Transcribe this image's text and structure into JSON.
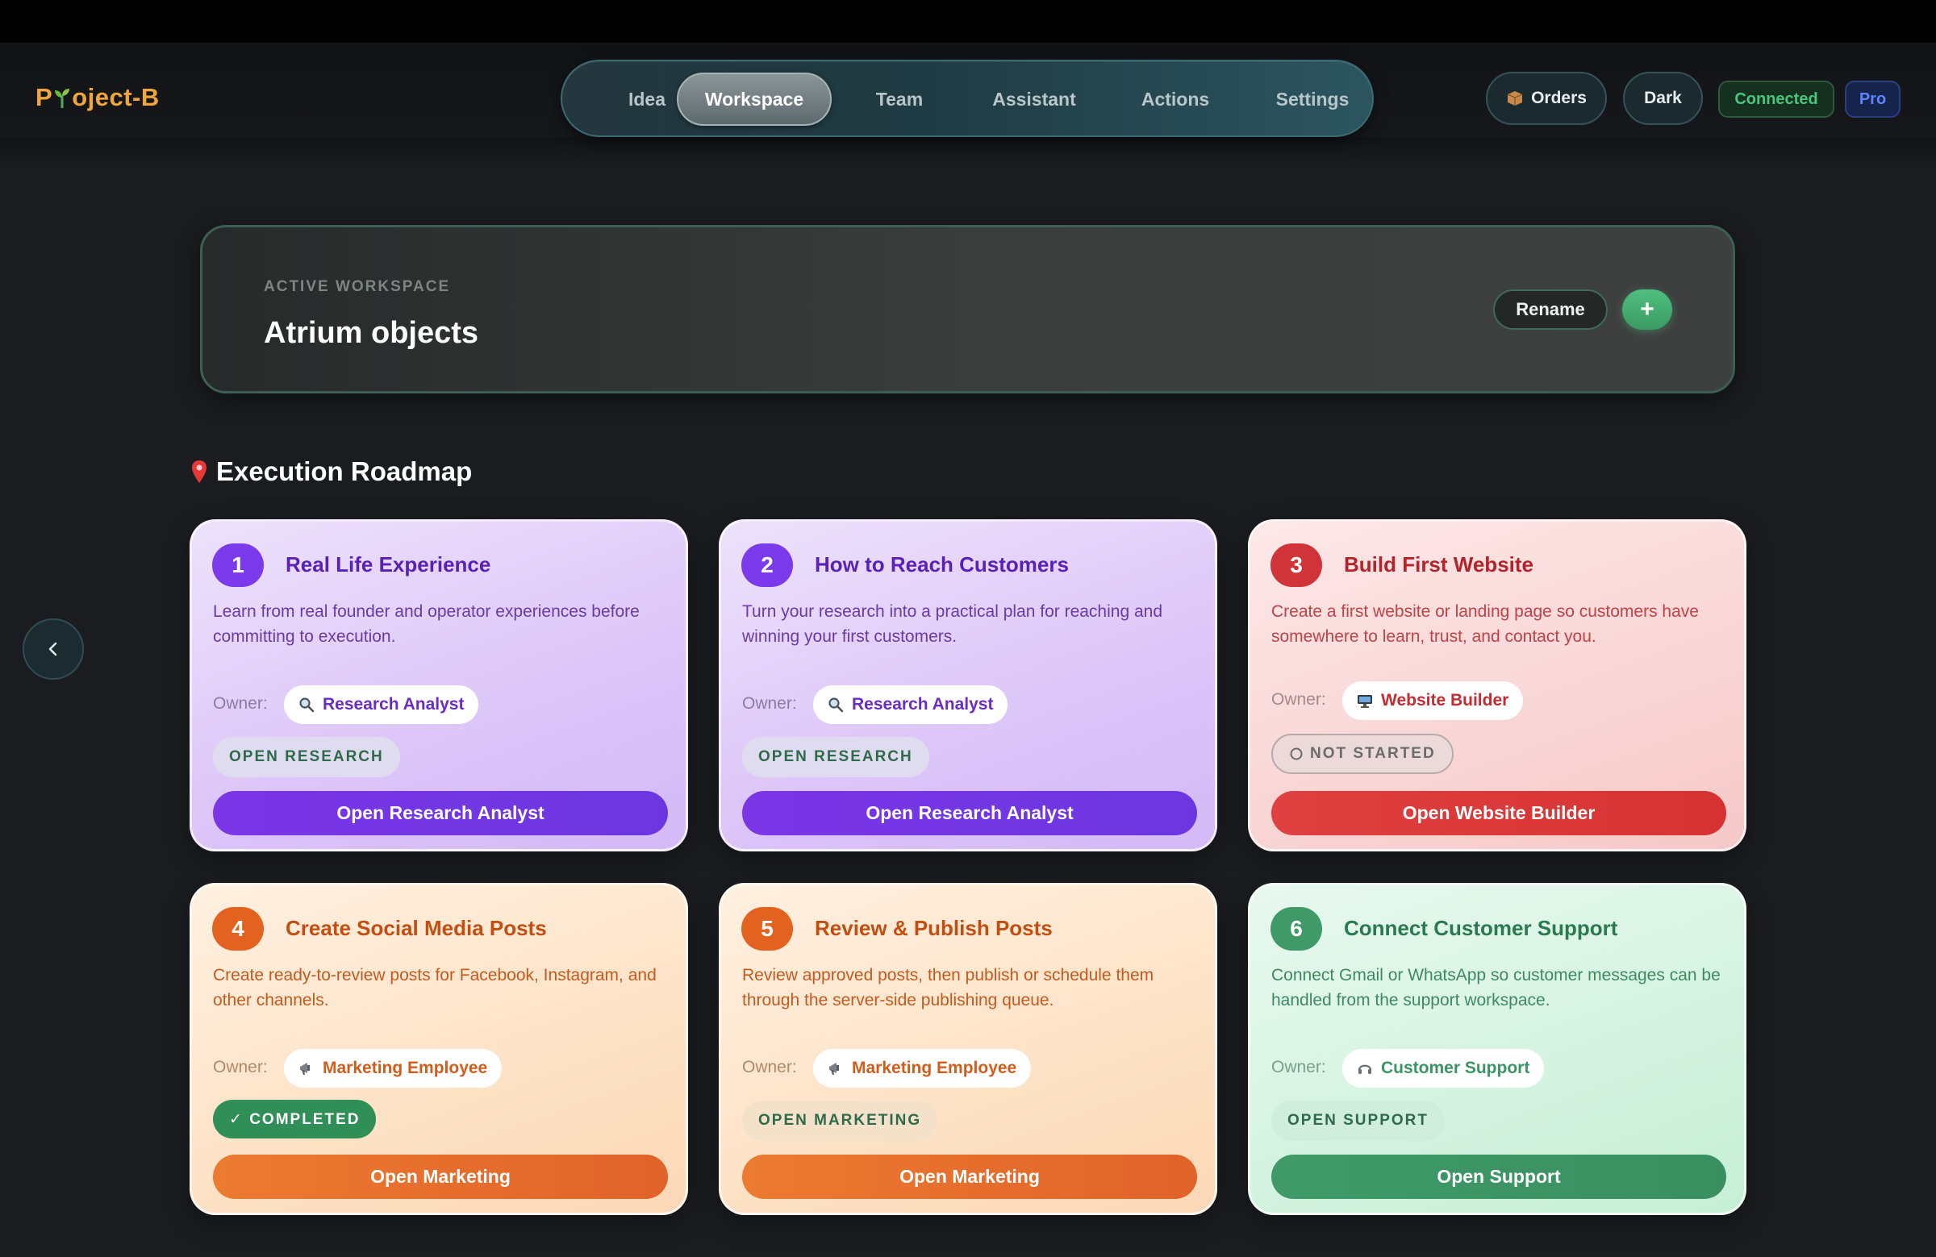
{
  "app": {
    "logo_left": "P",
    "logo_right": "oject-B"
  },
  "nav": {
    "items": [
      {
        "label": "Idea"
      },
      {
        "label": "Workspace",
        "active": true
      },
      {
        "label": "Team"
      },
      {
        "label": "Assistant"
      },
      {
        "label": "Actions"
      },
      {
        "label": "Settings"
      }
    ]
  },
  "header": {
    "orders_label": "Orders",
    "theme_label": "Dark",
    "status_label": "Connected",
    "plan_label": "Pro"
  },
  "workspace": {
    "label": "ACTIVE WORKSPACE",
    "title": "Atrium objects",
    "rename_label": "Rename",
    "add_label": "+"
  },
  "roadmap": {
    "title": "Execution Roadmap",
    "owner_prefix": "Owner:",
    "steps": [
      {
        "number": "1",
        "title": "Real Life Experience",
        "description": "Learn from real founder and operator experiences before committing to execution.",
        "owner": "Research Analyst",
        "owner_icon": "magnifier-icon",
        "status": "OPEN RESEARCH",
        "action": "Open Research Analyst",
        "theme": "purple"
      },
      {
        "number": "2",
        "title": "How to Reach Customers",
        "description": "Turn your research into a practical plan for reaching and winning your first customers.",
        "owner": "Research Analyst",
        "owner_icon": "magnifier-icon",
        "status": "OPEN RESEARCH",
        "action": "Open Research Analyst",
        "theme": "purple"
      },
      {
        "number": "3",
        "title": "Build First Website",
        "description": "Create a first website or landing page so customers have somewhere to learn, trust, and contact you.",
        "owner": "Website Builder",
        "owner_icon": "monitor-icon",
        "status": "NOT STARTED",
        "action": "Open Website Builder",
        "theme": "red"
      },
      {
        "number": "4",
        "title": "Create Social Media Posts",
        "description": "Create ready-to-review posts for Facebook, Instagram, and other channels.",
        "owner": "Marketing Employee",
        "owner_icon": "megaphone-icon",
        "status": "✓ COMPLETED",
        "action": "Open Marketing",
        "theme": "orange"
      },
      {
        "number": "5",
        "title": "Review & Publish Posts",
        "description": "Review approved posts, then publish or schedule them through the server-side publishing queue.",
        "owner": "Marketing Employee",
        "owner_icon": "megaphone-icon",
        "status": "OPEN MARKETING",
        "action": "Open Marketing",
        "theme": "orange"
      },
      {
        "number": "6",
        "title": "Connect Customer Support",
        "description": "Connect Gmail or WhatsApp so customer messages can be handled from the support workspace.",
        "owner": "Customer Support",
        "owner_icon": "headset-icon",
        "status": "OPEN SUPPORT",
        "action": "Open Support",
        "theme": "green"
      }
    ]
  },
  "colors": {
    "purple_accent": "#7c3aed",
    "red_accent": "#dc3a3a",
    "orange_accent": "#e96a24",
    "green_accent": "#3f9a68",
    "completed_green": "#2f8f57",
    "logo": "#f0a63a"
  }
}
